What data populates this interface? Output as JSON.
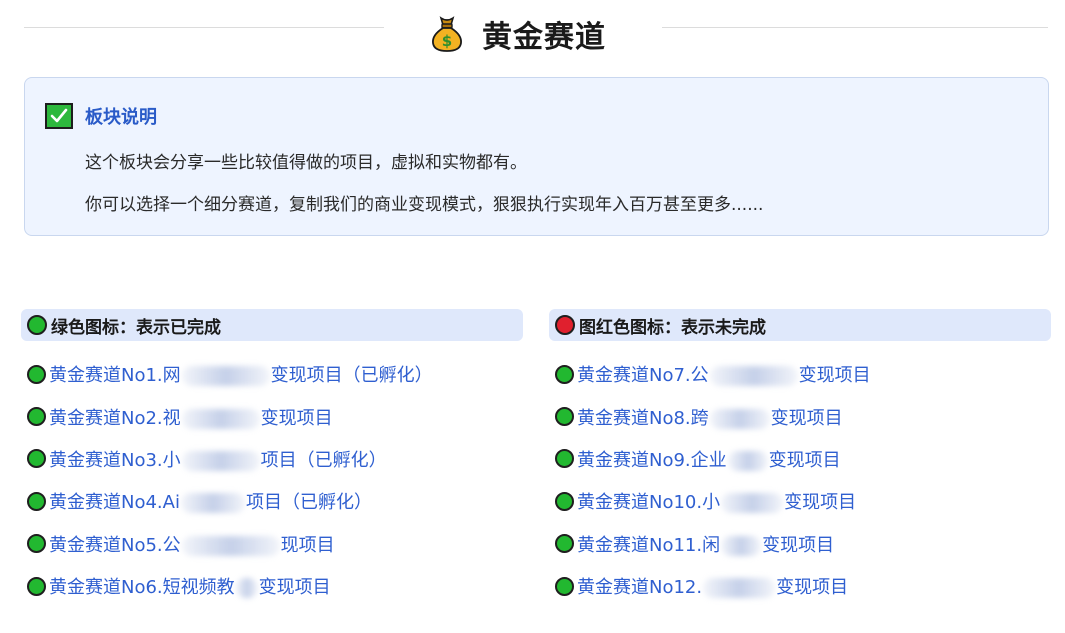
{
  "header": {
    "icon": "money-bag-icon",
    "title": "黄金赛道"
  },
  "info": {
    "icon": "checkmark-icon",
    "title": "板块说明",
    "line1": "这个板块会分享一些比较值得做的项目，虚拟和实物都有。",
    "line2": "你可以选择一个细分赛道，复制我们的商业变现模式，狠狠执行实现年入百万甚至更多......"
  },
  "colors": {
    "green": "#22b830",
    "red": "#e0202e",
    "link": "#2f5fd0",
    "accent": "#2a5bc8"
  },
  "completed": {
    "heading": "绿色图标：表示已完成",
    "items": [
      {
        "pre": "黄金赛道No1.网",
        "post": "变现项目（已孵化）"
      },
      {
        "pre": "黄金赛道No2.视",
        "post": "变现项目"
      },
      {
        "pre": "黄金赛道No3.小",
        "post": "项目（已孵化）"
      },
      {
        "pre": "黄金赛道No4.Ai",
        "post": "项目（已孵化）"
      },
      {
        "pre": "黄金赛道No5.公",
        "post": "现项目"
      },
      {
        "pre": "黄金赛道No6.短视频教",
        "post": "变现项目"
      }
    ]
  },
  "incomplete": {
    "heading": "图红色图标：表示未完成",
    "items": [
      {
        "pre": "黄金赛道No7.公",
        "post": "变现项目"
      },
      {
        "pre": "黄金赛道No8.跨",
        "post": "变现项目"
      },
      {
        "pre": "黄金赛道No9.企业",
        "post": "变现项目"
      },
      {
        "pre": "黄金赛道No10.小",
        "post": "变现项目"
      },
      {
        "pre": "黄金赛道No11.闲",
        "post": "变现项目"
      },
      {
        "pre": "黄金赛道No12.",
        "post": "变现项目"
      }
    ]
  }
}
